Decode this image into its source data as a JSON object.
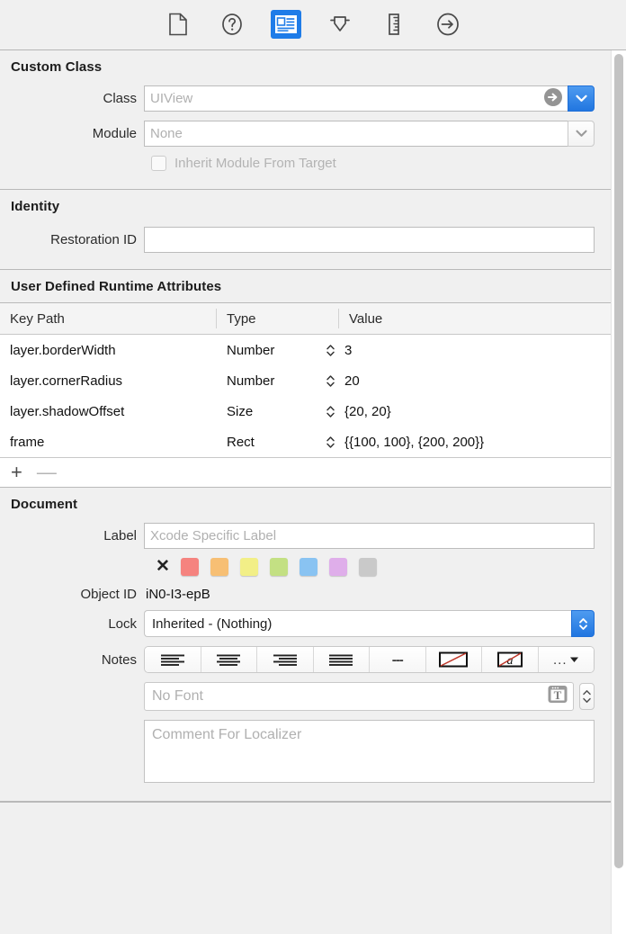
{
  "toolbar": {
    "items": [
      {
        "name": "file-inspector-icon",
        "label": "File inspector",
        "active": false
      },
      {
        "name": "quick-help-icon",
        "label": "Quick Help inspector",
        "active": false
      },
      {
        "name": "identity-inspector-icon",
        "label": "Identity inspector",
        "active": true
      },
      {
        "name": "attributes-inspector-icon",
        "label": "Attributes inspector",
        "active": false
      },
      {
        "name": "size-inspector-icon",
        "label": "Size inspector",
        "active": false
      },
      {
        "name": "connections-inspector-icon",
        "label": "Connections inspector",
        "active": false
      }
    ],
    "accent_color": "#1f7ce8"
  },
  "custom_class": {
    "title": "Custom Class",
    "class_label": "Class",
    "class_placeholder": "UIView",
    "class_value": "",
    "module_label": "Module",
    "module_placeholder": "None",
    "module_value": "",
    "inherit_label": "Inherit Module From Target",
    "inherit_checked": false
  },
  "identity": {
    "title": "Identity",
    "restoration_label": "Restoration ID",
    "restoration_value": "",
    "restoration_placeholder": ""
  },
  "runtime_attributes": {
    "title": "User Defined Runtime Attributes",
    "columns": [
      "Key Path",
      "Type",
      "Value"
    ],
    "rows": [
      {
        "key_path": "layer.borderWidth",
        "type": "Number",
        "value": "3"
      },
      {
        "key_path": "layer.cornerRadius",
        "type": "Number",
        "value": "20"
      },
      {
        "key_path": "layer.shadowOffset",
        "type": "Size",
        "value": "{20, 20}"
      },
      {
        "key_path": "frame",
        "type": "Rect",
        "value": "{{100, 100}, {200, 200}}"
      }
    ],
    "add_label": "+",
    "remove_label": "—"
  },
  "document": {
    "title": "Document",
    "label_label": "Label",
    "label_placeholder": "Xcode Specific Label",
    "label_value": "",
    "swatches": [
      {
        "name": "no-color",
        "color": "none"
      },
      {
        "name": "red",
        "color": "#f5837f"
      },
      {
        "name": "orange",
        "color": "#f7bf74"
      },
      {
        "name": "yellow",
        "color": "#f2ef87"
      },
      {
        "name": "green",
        "color": "#c3e083"
      },
      {
        "name": "blue",
        "color": "#89c3f2"
      },
      {
        "name": "purple",
        "color": "#dfaeea"
      },
      {
        "name": "gray",
        "color": "#c9c9c9"
      }
    ],
    "object_id_label": "Object ID",
    "object_id_value": "iN0-I3-epB",
    "lock_label": "Lock",
    "lock_value": "Inherited - (Nothing)",
    "notes_label": "Notes",
    "notes_buttons": [
      {
        "name": "align-left",
        "glyph": "align-left"
      },
      {
        "name": "align-center",
        "glyph": "align-center"
      },
      {
        "name": "align-right",
        "glyph": "align-right"
      },
      {
        "name": "align-justify",
        "glyph": "align-justify"
      },
      {
        "name": "dashes",
        "glyph": "---"
      },
      {
        "name": "no-background-color",
        "glyph": "rect-slash"
      },
      {
        "name": "no-text-color",
        "glyph": "a-slash"
      },
      {
        "name": "more-options",
        "glyph": "..."
      }
    ],
    "more_label": "...",
    "font_placeholder": "No Font",
    "font_value": "",
    "comment_placeholder": "Comment For Localizer",
    "comment_value": ""
  }
}
